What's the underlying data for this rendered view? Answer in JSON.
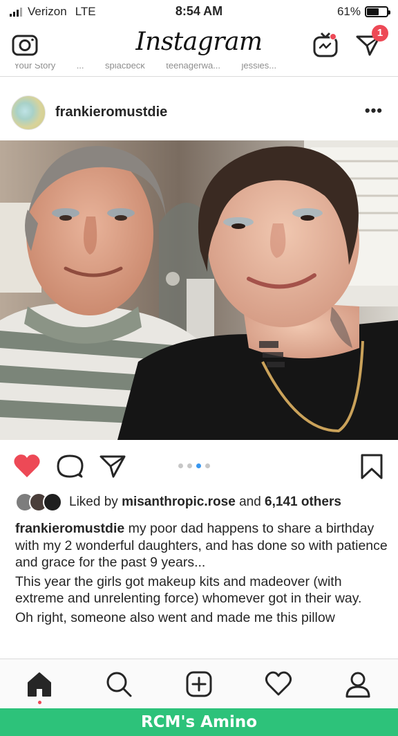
{
  "status_bar": {
    "carrier": "Verizon",
    "network": "LTE",
    "time": "8:54 AM",
    "battery_percent": "61%",
    "battery_level": 0.61
  },
  "top_nav": {
    "logo": "Instagram",
    "direct_badge_count": "1"
  },
  "stories": [
    "Your Story",
    "...",
    "splacbeck",
    "teenagerwa...",
    "jessies..."
  ],
  "post": {
    "username": "frankieromustdie",
    "more": "•••",
    "carousel": {
      "count": 4,
      "active_index": 2
    },
    "liked": true,
    "likes": {
      "prefix": "Liked by",
      "liker": "misanthropic.rose",
      "connector": "and",
      "others": "6,141 others"
    },
    "caption": {
      "username": "frankieromustdie",
      "paragraph1": "my poor dad happens to share a birthday with my 2 wonderful daughters, and has done so with patience and grace for the past 9 years...",
      "paragraph2": "This year the girls got makeup kits and madeover (with extreme and unrelenting force) whomever got in their way.",
      "paragraph3": "Oh right, someone also went and made me this pillow"
    }
  },
  "tab_bar": {
    "active": "home",
    "items": [
      "home-icon",
      "search-icon",
      "add-post-icon",
      "activity-heart-icon",
      "profile-icon"
    ]
  },
  "footer": {
    "label": "RCM's Amino"
  },
  "colors": {
    "like_red": "#ed4956",
    "carousel_active": "#3897f0",
    "amino_green": "#2dc27a"
  }
}
